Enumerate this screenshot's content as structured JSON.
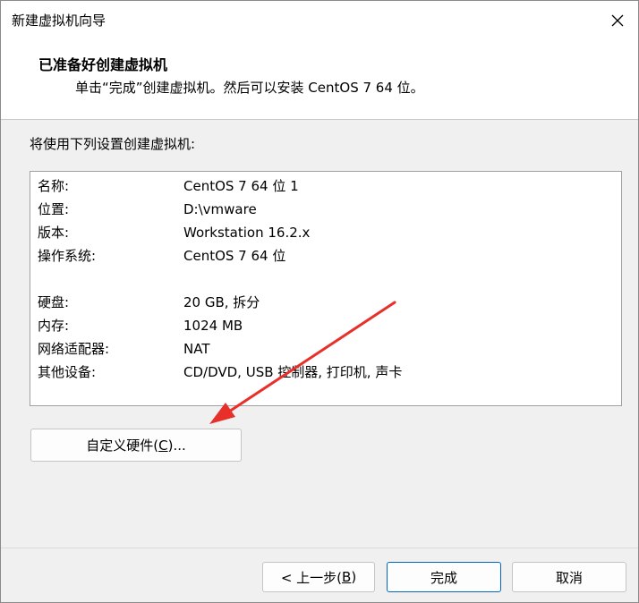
{
  "window": {
    "title": "新建虚拟机向导"
  },
  "header": {
    "title": "已准备好创建虚拟机",
    "subtitle": "单击“完成”创建虚拟机。然后可以安装 CentOS 7 64 位。"
  },
  "intro": "将使用下列设置创建虚拟机:",
  "summary": {
    "rows": [
      {
        "label": "名称:",
        "value": "CentOS 7 64 位 1"
      },
      {
        "label": "位置:",
        "value": "D:\\vmware"
      },
      {
        "label": "版本:",
        "value": "Workstation 16.2.x"
      },
      {
        "label": "操作系统:",
        "value": "CentOS 7 64 位"
      },
      {
        "label": "硬盘:",
        "value": "20 GB, 拆分"
      },
      {
        "label": "内存:",
        "value": "1024 MB"
      },
      {
        "label": "网络适配器:",
        "value": "NAT"
      },
      {
        "label": "其他设备:",
        "value": "CD/DVD, USB 控制器, 打印机, 声卡"
      }
    ]
  },
  "buttons": {
    "customize_prefix": "自定义硬件(",
    "customize_key": "C",
    "customize_suffix": ")...",
    "back_prefix": "< 上一步(",
    "back_key": "B",
    "back_suffix": ")",
    "finish": "完成",
    "cancel": "取消"
  },
  "colors": {
    "annotation_arrow": "#e8302a",
    "primary_border": "#0067c0"
  },
  "icons": {
    "close": "close-icon"
  }
}
